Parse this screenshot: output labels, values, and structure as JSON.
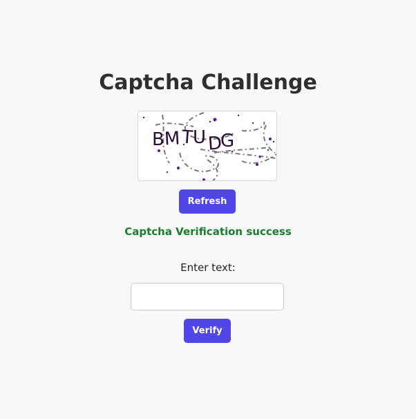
{
  "page": {
    "title": "Captcha Challenge"
  },
  "captcha": {
    "text": "BMTUDG",
    "characters": [
      "B",
      "M",
      "T",
      "U",
      "D",
      "G"
    ]
  },
  "refresh_button": {
    "label": "Refresh"
  },
  "status": {
    "message": "Captcha Verification success"
  },
  "input": {
    "label": "Enter text:",
    "value": "",
    "placeholder": ""
  },
  "verify_button": {
    "label": "Verify"
  },
  "colors": {
    "primary": "#4f46e5",
    "success": "#1a7f2a",
    "background": "#f7f8fa",
    "captcha_text": "#2a0a3a",
    "captcha_dots": "#5a1a8a",
    "captcha_lines": "#777777"
  }
}
